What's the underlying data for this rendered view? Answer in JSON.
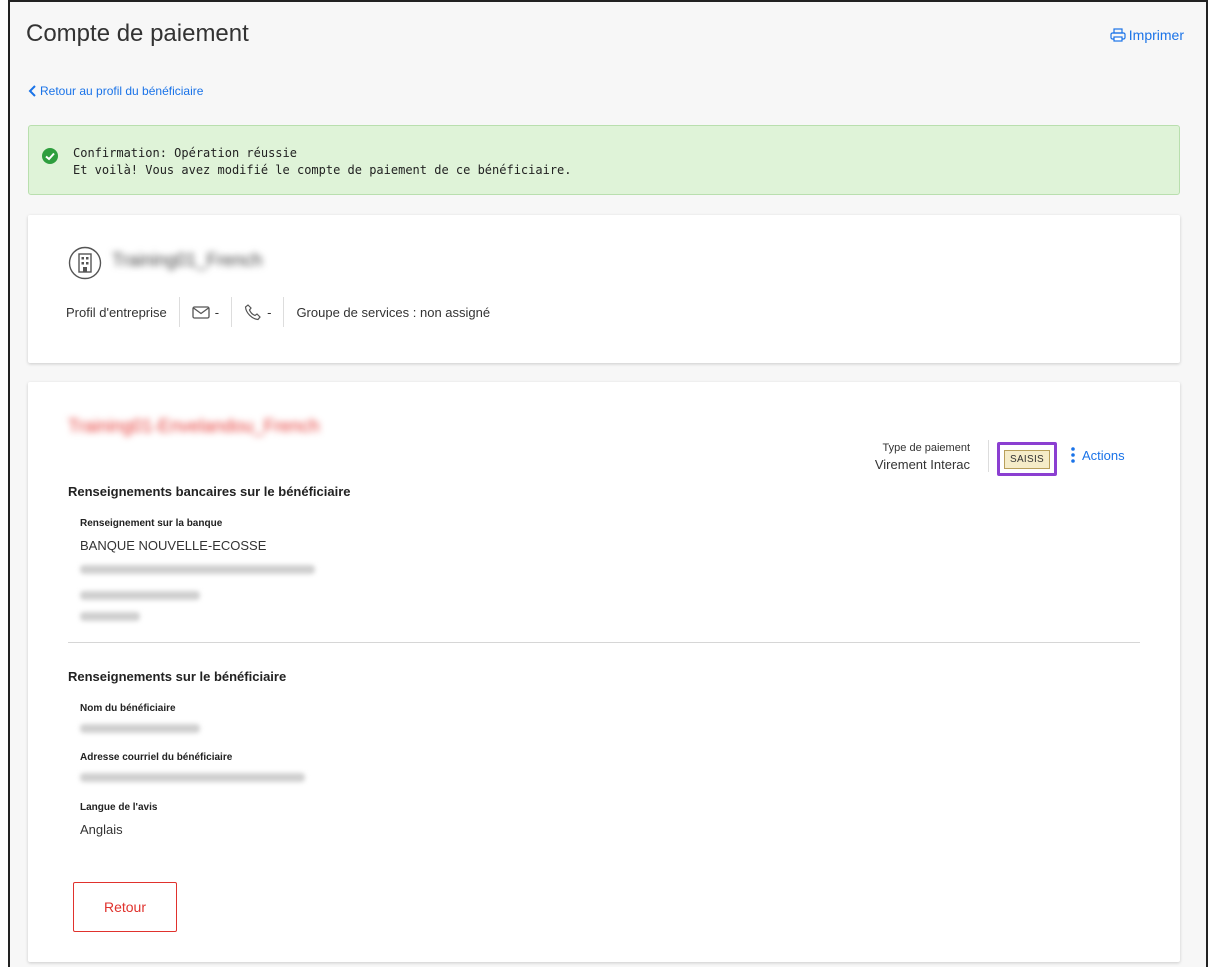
{
  "page": {
    "title": "Compte de paiement",
    "print_label": "Imprimer",
    "back_link_label": "Retour au profil du bénéficiaire"
  },
  "alert": {
    "title": "Confirmation: Opération réussie",
    "message": "Et voilà! Vous avez modifié le compte de paiement de ce bénéficiaire."
  },
  "profile": {
    "company_name": "Training01_French",
    "type_label": "Profil d'entreprise",
    "email_value": "-",
    "phone_value": "-",
    "service_group": "Groupe de services : non assigné"
  },
  "account": {
    "name": "Training01-Envelandou_French",
    "payment_type_label": "Type de paiement",
    "payment_type_value": "Virement Interac",
    "status": "SAISIS",
    "actions_label": "Actions"
  },
  "bank_section": {
    "title": "Renseignements bancaires sur le bénéficiaire",
    "bank_label": "Renseignement sur la banque",
    "bank_name": "BANQUE NOUVELLE-ECOSSE"
  },
  "beneficiary_section": {
    "title": "Renseignements sur le bénéficiaire",
    "name_label": "Nom du bénéficiaire",
    "email_label": "Adresse courriel du bénéficiaire",
    "language_label": "Langue de l'avis",
    "language_value": "Anglais"
  },
  "buttons": {
    "back": "Retour"
  },
  "colors": {
    "link": "#1a73e8",
    "success_bg": "#dff3d8",
    "success_icon": "#2e9e3e",
    "danger": "#e0322d",
    "highlight": "#8b3fd1"
  }
}
